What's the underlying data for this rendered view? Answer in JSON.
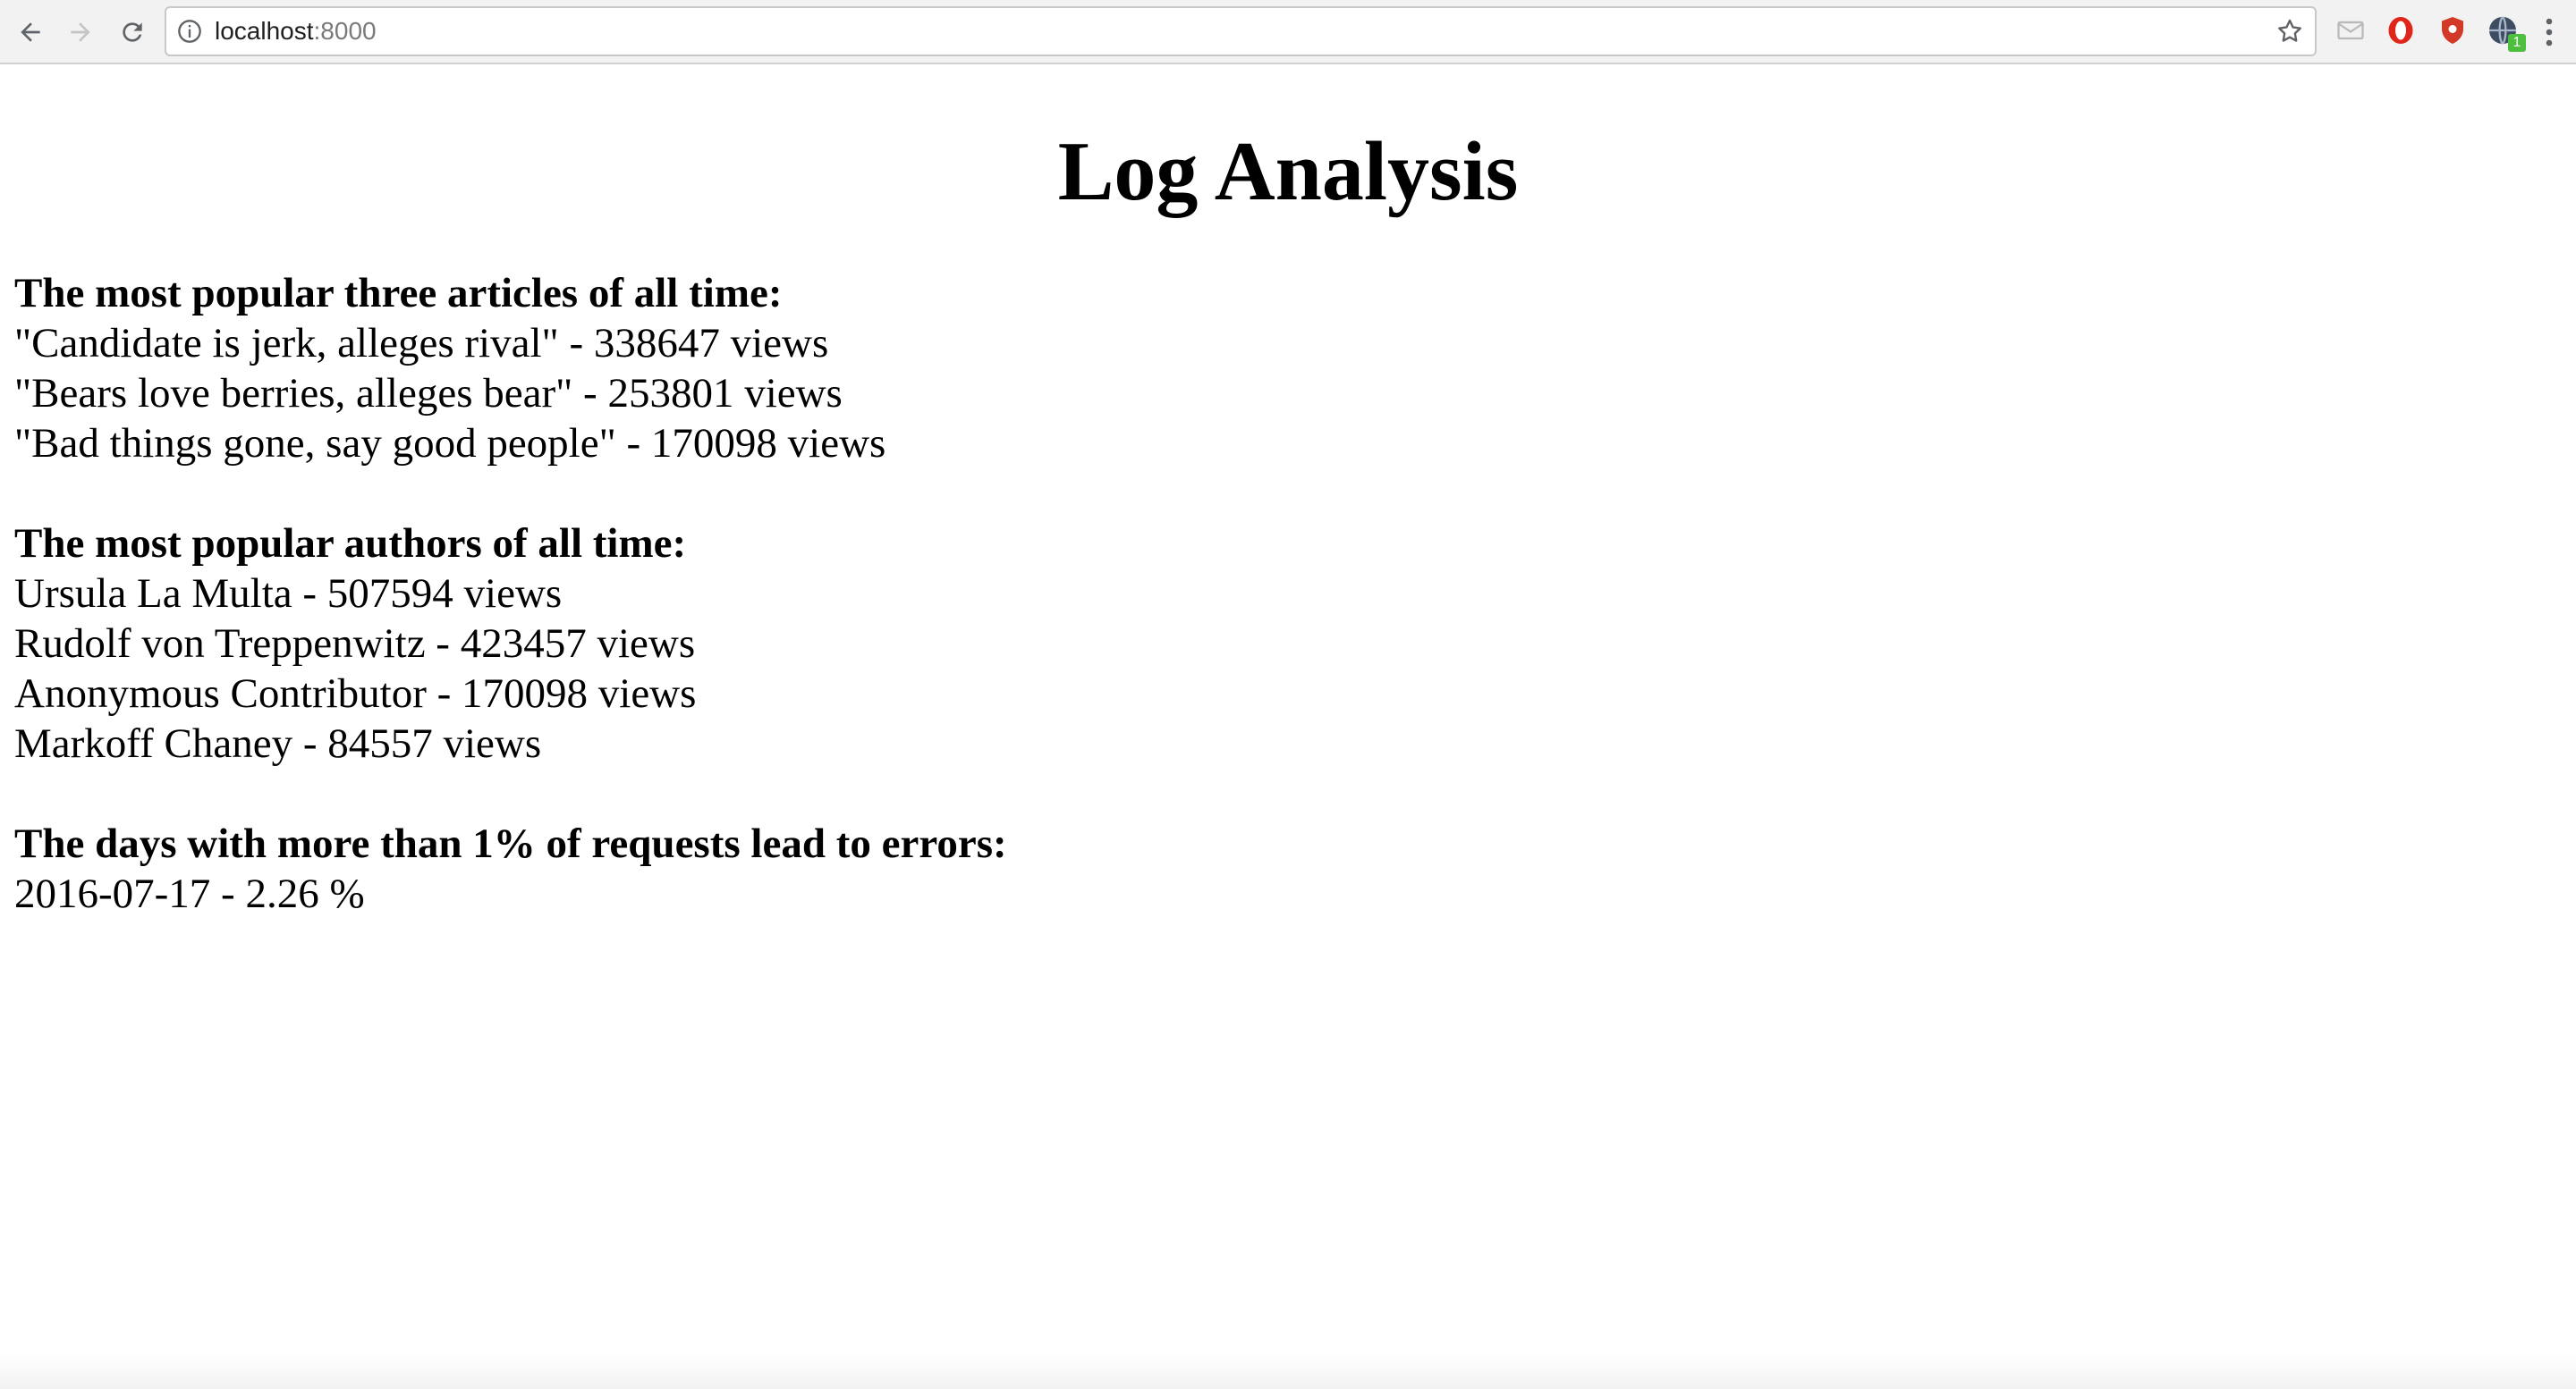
{
  "browser": {
    "url_host": "localhost",
    "url_port": ":8000",
    "extensions": [
      {
        "name": "mail-icon"
      },
      {
        "name": "opera-icon",
        "color": "#e0261b"
      },
      {
        "name": "shield-icon",
        "color": "#d23a27"
      },
      {
        "name": "globe-icon",
        "badge": "1",
        "badge_color": "#4cbf3f"
      }
    ]
  },
  "page": {
    "title": "Log Analysis",
    "sections": [
      {
        "heading": "The most popular three articles of all time:",
        "entries": [
          "\"Candidate is jerk, alleges rival\" - 338647 views",
          "\"Bears love berries, alleges bear\" - 253801 views",
          "\"Bad things gone, say good people\" - 170098 views"
        ]
      },
      {
        "heading": "The most popular authors of all time:",
        "entries": [
          "Ursula La Multa - 507594 views",
          "Rudolf von Treppenwitz - 423457 views",
          "Anonymous Contributor - 170098 views",
          "Markoff Chaney - 84557 views"
        ]
      },
      {
        "heading": "The days with more than 1% of requests lead to errors:",
        "entries": [
          "2016-07-17 - 2.26 %"
        ]
      }
    ]
  }
}
